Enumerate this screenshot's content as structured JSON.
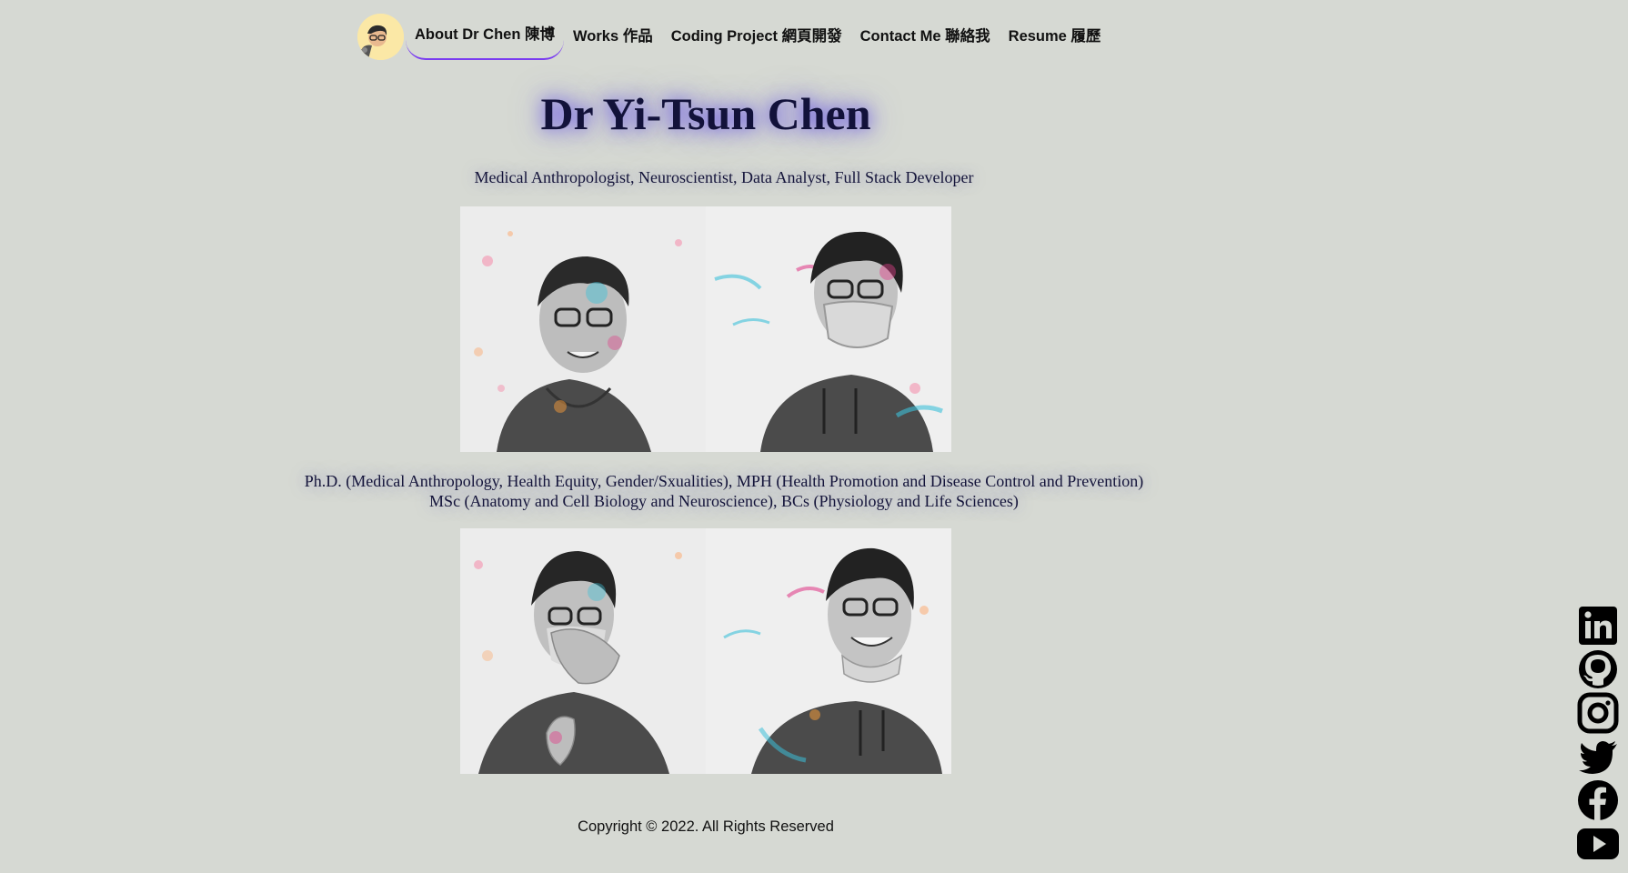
{
  "nav": {
    "items": [
      {
        "label": "About Dr Chen 陳博",
        "active": true
      },
      {
        "label": "Works 作品",
        "active": false
      },
      {
        "label": "Coding Project 網頁開發",
        "active": false
      },
      {
        "label": "Contact Me 聯絡我",
        "active": false
      },
      {
        "label": "Resume 履歷",
        "active": false
      }
    ],
    "logo_icon": "avatar-logo-icon",
    "active_underline_color": "#7a3cf0"
  },
  "hero": {
    "name": "Dr Yi-Tsun Chen",
    "subtitle": "Medical Anthropologist, Neuroscientist, Data Analyst, Full Stack Developer",
    "degrees_line1": "Ph.D. (Medical Anthropology, Health Equity, Gender/Sxualities), MPH (Health Promotion and Disease Control and Prevention)",
    "degrees_line2": "MSc (Anatomy and Cell Biology and Neuroscience), BCs (Physiology and Life Sciences)",
    "glow_color": "#5a46e6"
  },
  "photos": [
    {
      "icon": "portrait-smiling-icon"
    },
    {
      "icon": "portrait-masked-icon"
    },
    {
      "icon": "portrait-hand-over-face-icon"
    },
    {
      "icon": "portrait-laughing-icon"
    }
  ],
  "footer": {
    "copyright": "Copyright © 2022. All Rights Reserved"
  },
  "social": [
    {
      "icon": "linkedin-icon"
    },
    {
      "icon": "github-icon"
    },
    {
      "icon": "instagram-icon"
    },
    {
      "icon": "twitter-icon"
    },
    {
      "icon": "facebook-icon"
    },
    {
      "icon": "youtube-icon"
    }
  ],
  "colors": {
    "background": "#d6d9d3",
    "logo_bg": "#fbe8a6",
    "title_text": "#12123a"
  }
}
